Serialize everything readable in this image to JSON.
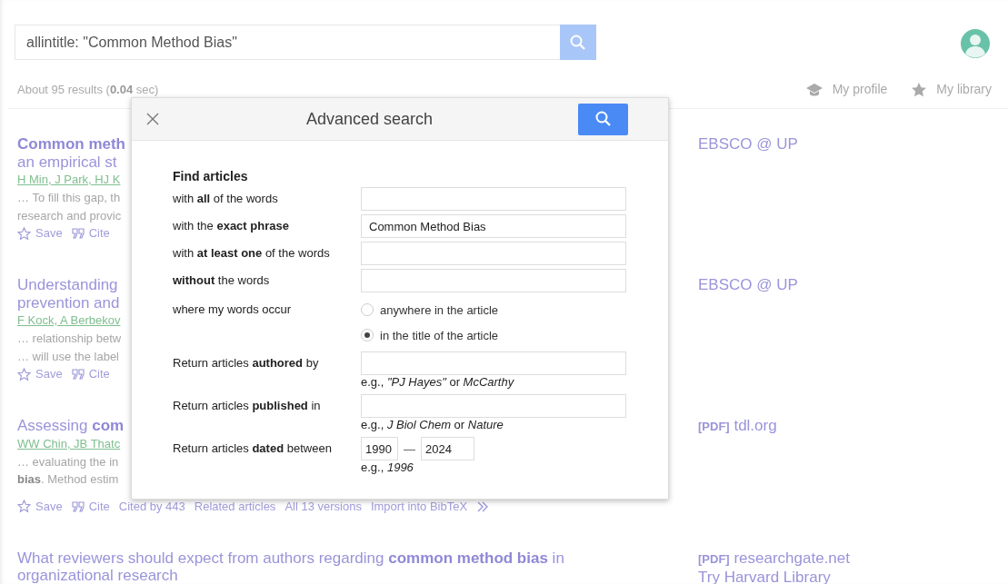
{
  "search": {
    "value": "allintitle: \"Common Method Bias\""
  },
  "results_summary": "About 95 results (**0.04** sec)",
  "nav": [
    {
      "kind": "profile",
      "label": "My profile"
    },
    {
      "kind": "library",
      "label": "My library"
    }
  ],
  "results": [
    {
      "title_lines": [
        "**Common meth**",
        "an empirical st"
      ],
      "authors": "H Min, J Park, HJ K",
      "snippet_lines": [
        "… To fill this gap, th",
        "research and provic"
      ],
      "actions": [
        {
          "kind": "save",
          "label": "Save"
        },
        {
          "kind": "cite",
          "label": "Cite"
        }
      ],
      "side_links": [
        {
          "text": "EBSCO @ UP"
        }
      ]
    },
    {
      "title_lines": [
        "Understanding",
        "prevention and"
      ],
      "authors": "F Kock, A Berbekov",
      "snippet_lines": [
        "… relationship betw",
        "… will use the label"
      ],
      "actions": [
        {
          "kind": "save",
          "label": "Save"
        },
        {
          "kind": "cite",
          "label": "Cite"
        }
      ],
      "side_links": [
        {
          "text": "EBSCO @ UP"
        }
      ]
    },
    {
      "title_lines": [
        "Assessing **com**"
      ],
      "authors": "WW Chin, JB Thatc",
      "snippet_lines": [
        "… evaluating the in",
        "**bias**. Method estim"
      ],
      "actions": [
        {
          "kind": "save",
          "label": "Save"
        },
        {
          "kind": "cite",
          "label": "Cite"
        },
        {
          "kind": "link",
          "label": "Cited by 443"
        },
        {
          "kind": "link",
          "label": "Related articles"
        },
        {
          "kind": "link",
          "label": "All 13 versions"
        },
        {
          "kind": "link",
          "label": "Import into BibTeX"
        },
        {
          "kind": "more"
        }
      ],
      "side_links": [
        {
          "tag": "[PDF]",
          "text": "tdl.org"
        }
      ]
    },
    {
      "title_lines": [
        "What reviewers should expect from authors regarding **common method bias** in",
        "organizational research"
      ],
      "side_links": [
        {
          "tag": "[PDF]",
          "text": "researchgate.net"
        },
        {
          "text": "Try Harvard Library"
        }
      ]
    }
  ],
  "dialog": {
    "title": "Advanced search",
    "rows": [
      {
        "kind": "heading",
        "label": "Find articles"
      },
      {
        "kind": "text",
        "label": "with **all** of the words"
      },
      {
        "kind": "text",
        "label": "with the **exact phrase**",
        "value": "Common Method Bias"
      },
      {
        "kind": "text",
        "label": "with **at least one** of the words"
      },
      {
        "kind": "text",
        "label": "**without** the words"
      },
      {
        "kind": "radio",
        "label": "where my words occur",
        "options": [
          {
            "label": "anywhere in the article",
            "selected": false
          },
          {
            "label": "in the title of the article",
            "selected": true
          }
        ]
      },
      {
        "kind": "text",
        "label": "Return articles **authored** by",
        "hint": "e.g., *\"PJ Hayes\"* or *McCarthy*"
      },
      {
        "kind": "text",
        "label": "Return articles **published** in",
        "hint": "e.g., *J Biol Chem* or *Nature*"
      },
      {
        "kind": "range",
        "label": "Return articles **dated** between",
        "from": "1990",
        "separator": "—",
        "to": "2024",
        "hint": "e.g., *1996*"
      }
    ]
  }
}
